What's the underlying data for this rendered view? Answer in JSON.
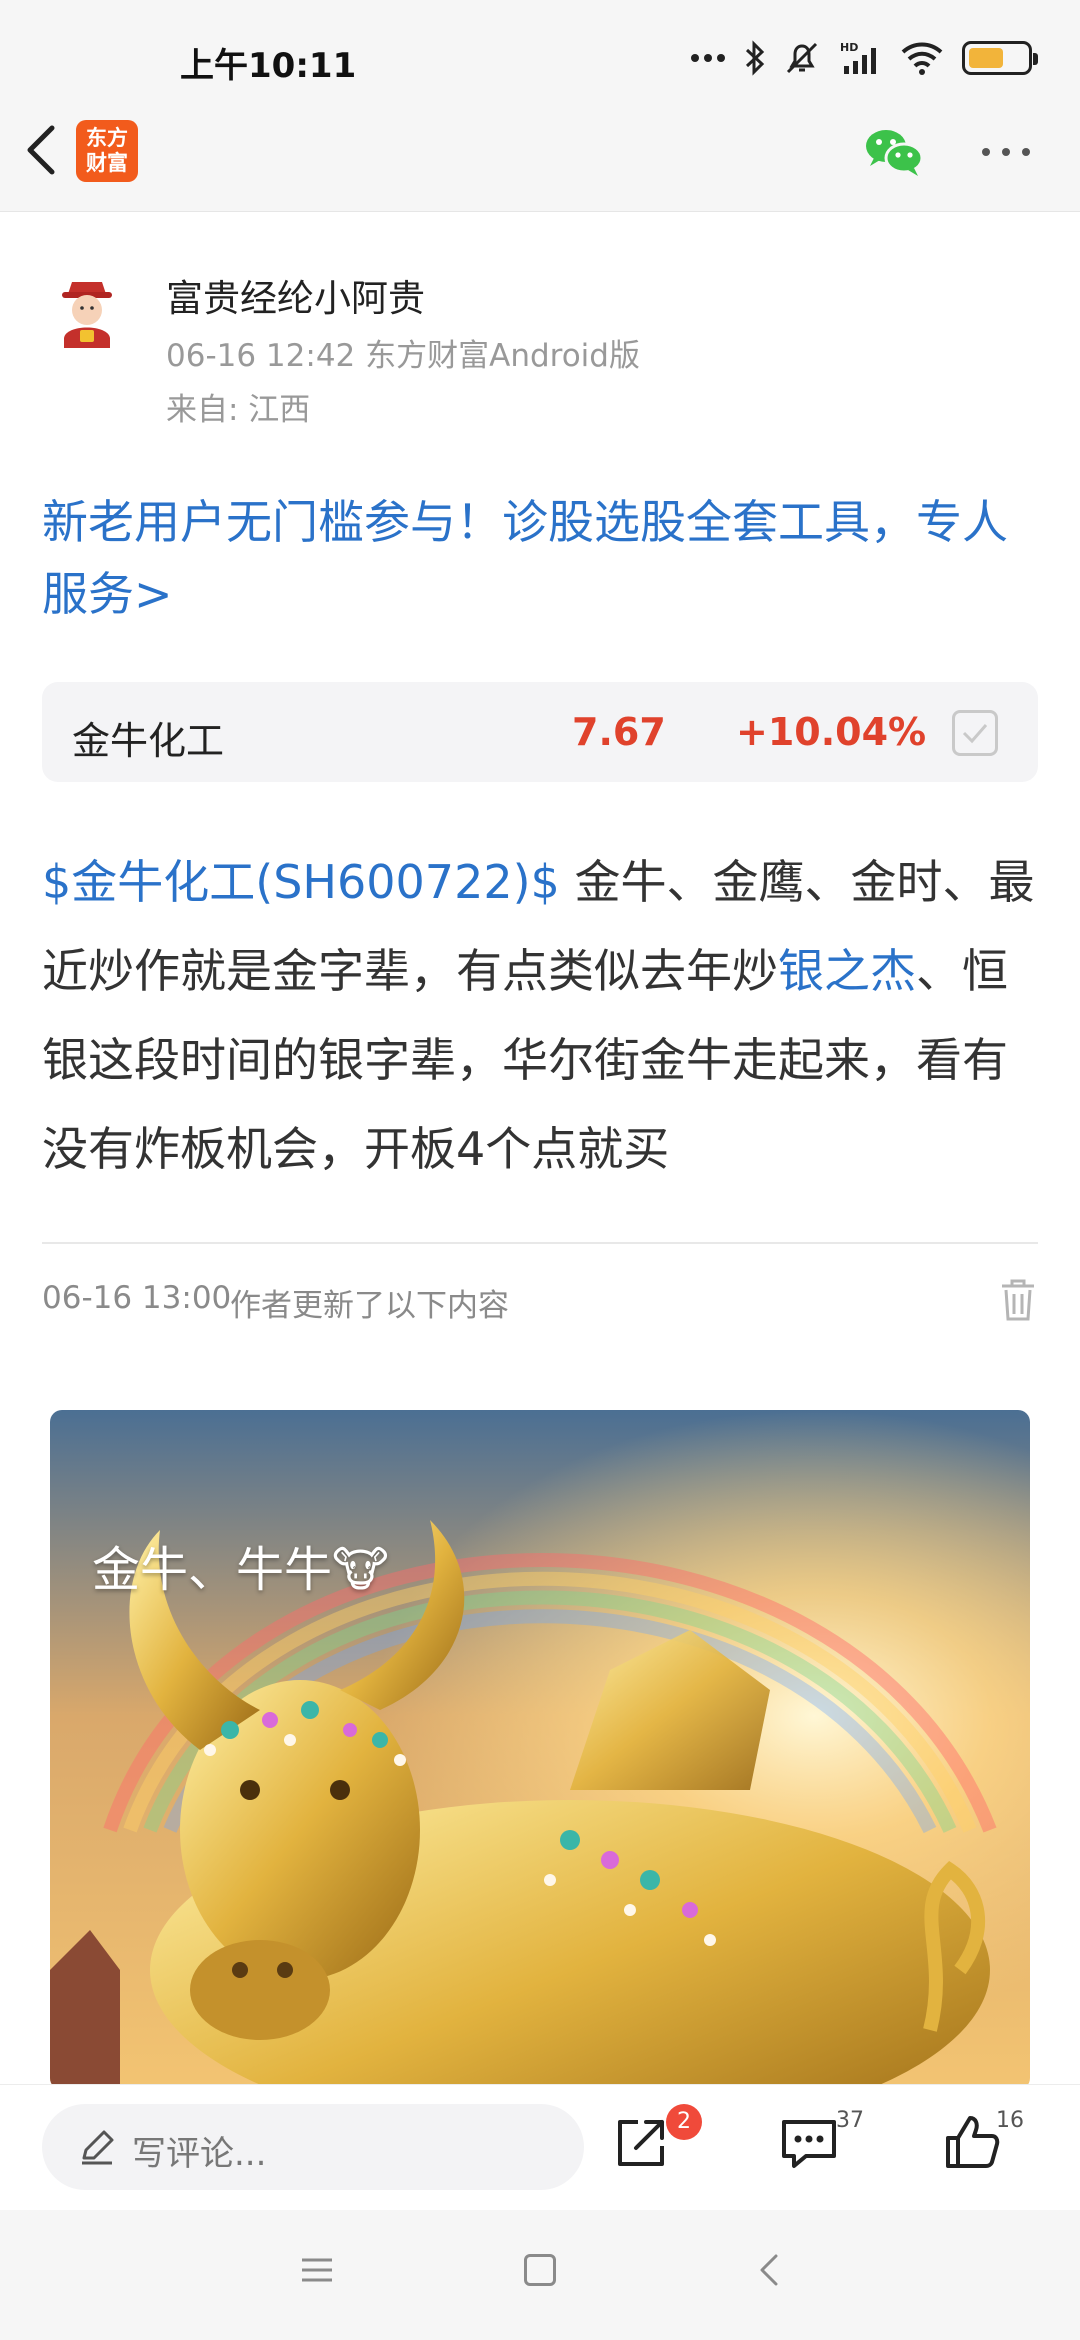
{
  "status_bar": {
    "time": "上午10:11",
    "icons": [
      "more-dots-icon",
      "bluetooth-icon",
      "mute-bell-icon",
      "signal-hd-icon",
      "wifi-icon",
      "battery-icon"
    ],
    "battery_level": 0.6
  },
  "nav": {
    "back_icon": "back-arrow-icon",
    "logo_text_line1": "东方",
    "logo_text_line2": "财富",
    "logo_color": "#f25b1c",
    "share_icon": "wechat-icon",
    "more_icon": "more-icon"
  },
  "author": {
    "name": "富贵经纶小阿贵",
    "meta": "06-16 12:42 东方财富Android版",
    "location": "来自: 江西"
  },
  "promo": {
    "text": "新老用户无门槛参与！诊股选股全套工具，专人服务>"
  },
  "stock": {
    "name": "金牛化工",
    "price": "7.67",
    "change": "+10.04%",
    "up_color": "#e0422c"
  },
  "post": {
    "stock_tag": "$金牛化工(SH600722)$",
    "text_1": " 金牛、金鹰、金时、最近炒作就是金字辈，有点类似去年炒",
    "link_1": "银之杰",
    "text_2": "、恒银这段时间的银字辈，华尔街金牛走起来，看有没有炸板机会，开板4个点就买",
    "link_color": "#2a72c9"
  },
  "update": {
    "time": "06-16 13:00",
    "note": "作者更新了以下内容",
    "delete_icon": "trash-icon"
  },
  "image": {
    "caption": "金牛、牛牛🐮"
  },
  "actions": {
    "comment_placeholder": "写评论...",
    "share_count": "2",
    "comment_count": "37",
    "like_count": "16"
  },
  "system_nav": {
    "icons": [
      "menu-icon",
      "home-icon",
      "back-icon"
    ]
  }
}
